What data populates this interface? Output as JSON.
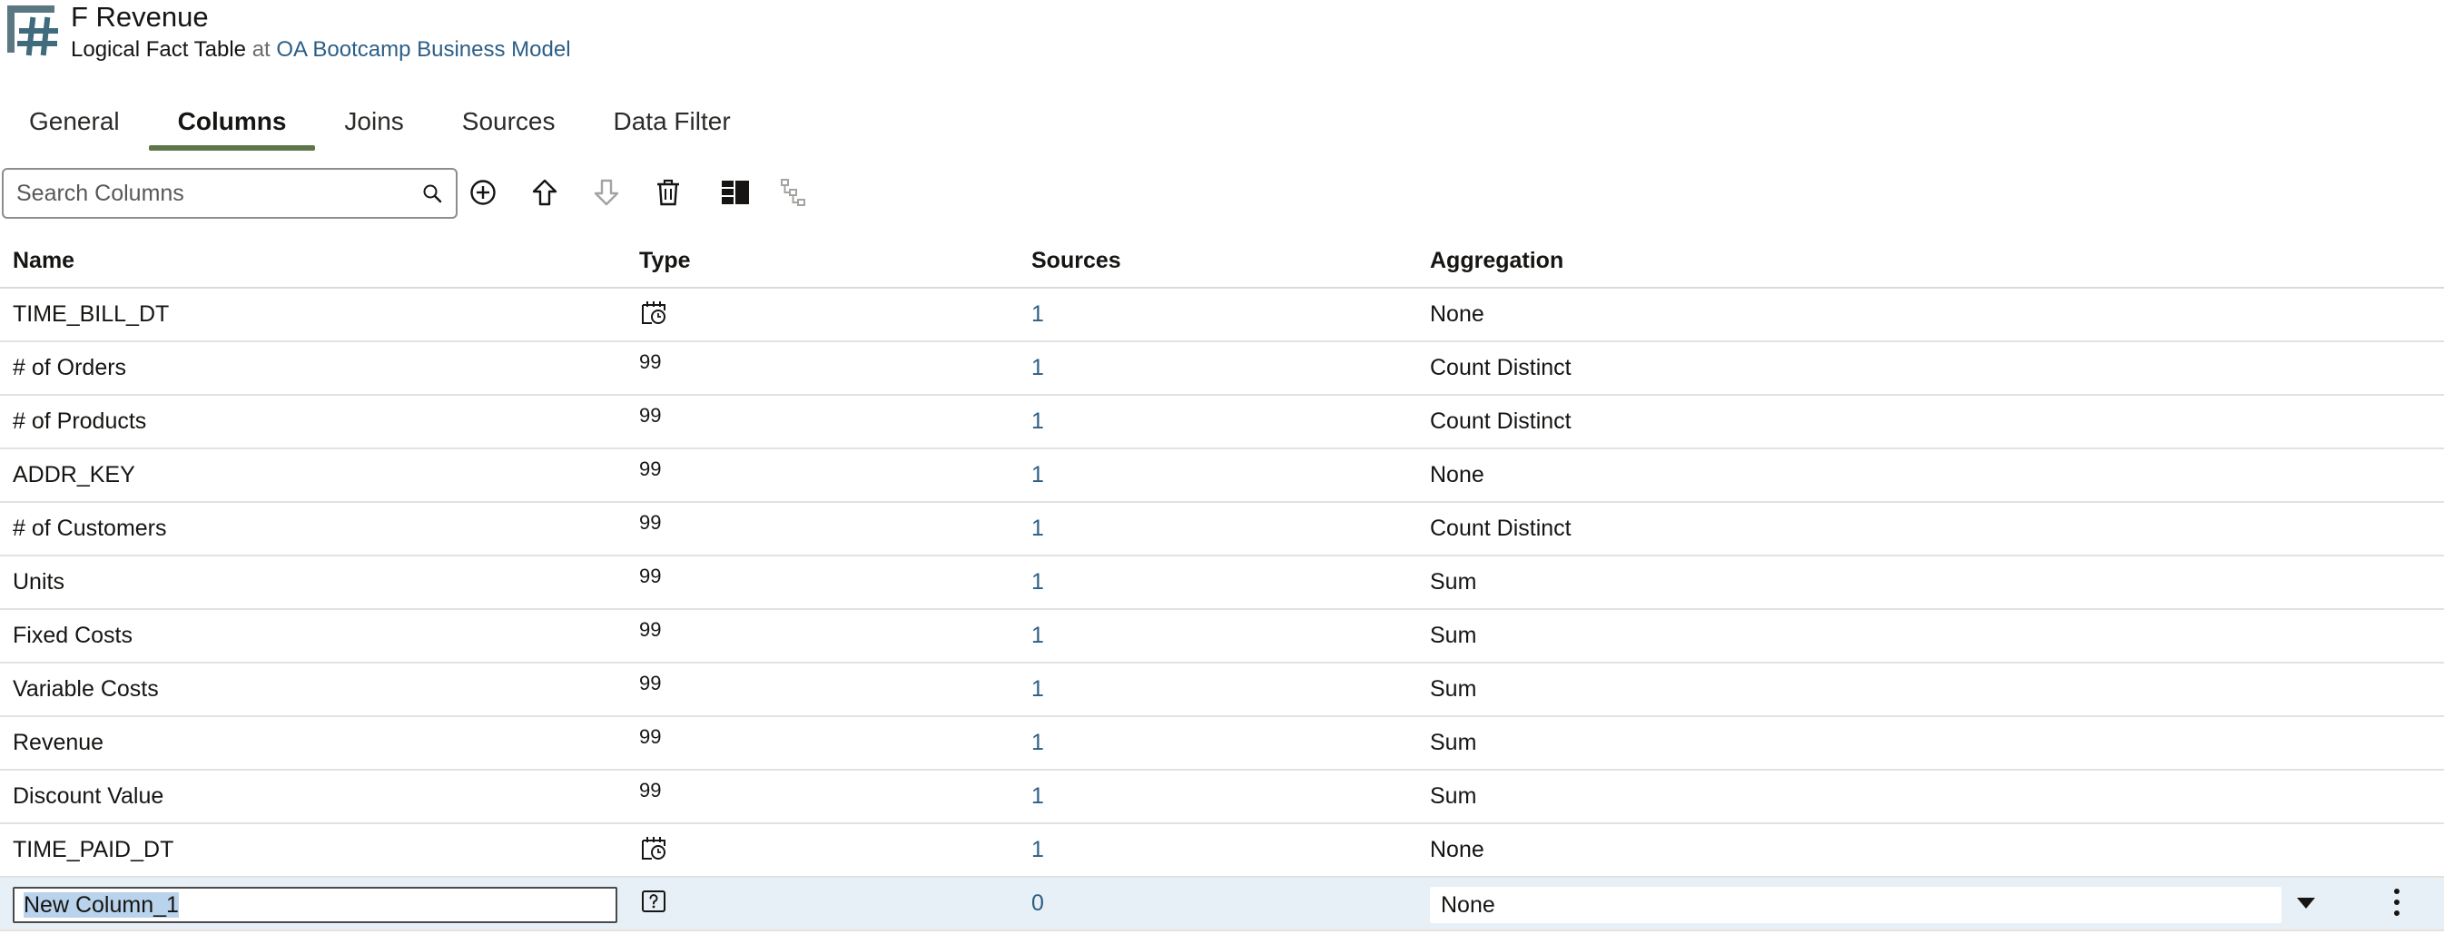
{
  "header": {
    "title": "F Revenue",
    "subtitle_type": "Logical Fact Table",
    "subtitle_at": "at",
    "subtitle_link": "OA Bootcamp Business Model",
    "icon": "logical-fact-table-icon"
  },
  "tabs": [
    {
      "label": "General",
      "active": false
    },
    {
      "label": "Columns",
      "active": true
    },
    {
      "label": "Joins",
      "active": false
    },
    {
      "label": "Sources",
      "active": false
    },
    {
      "label": "Data Filter",
      "active": false
    }
  ],
  "toolbar": {
    "search_placeholder": "Search Columns",
    "search_value": "",
    "icons": [
      "add-icon",
      "move-up-icon",
      "move-down-icon",
      "delete-icon",
      "detail-view-icon",
      "hierarchy-icon"
    ]
  },
  "table": {
    "headers": {
      "name": "Name",
      "type": "Type",
      "sources": "Sources",
      "aggregation": "Aggregation"
    },
    "rows": [
      {
        "name": "TIME_BILL_DT",
        "type": "date",
        "sources": "1",
        "aggregation": "None"
      },
      {
        "name": "# of Orders",
        "type": "99",
        "sources": "1",
        "aggregation": "Count Distinct"
      },
      {
        "name": "# of Products",
        "type": "99",
        "sources": "1",
        "aggregation": "Count Distinct"
      },
      {
        "name": "ADDR_KEY",
        "type": "99",
        "sources": "1",
        "aggregation": "None"
      },
      {
        "name": "# of Customers",
        "type": "99",
        "sources": "1",
        "aggregation": "Count Distinct"
      },
      {
        "name": "Units",
        "type": "99",
        "sources": "1",
        "aggregation": "Sum"
      },
      {
        "name": "Fixed Costs",
        "type": "99",
        "sources": "1",
        "aggregation": "Sum"
      },
      {
        "name": "Variable Costs",
        "type": "99",
        "sources": "1",
        "aggregation": "Sum"
      },
      {
        "name": "Revenue",
        "type": "99",
        "sources": "1",
        "aggregation": "Sum"
      },
      {
        "name": "Discount Value",
        "type": "99",
        "sources": "1",
        "aggregation": "Sum"
      },
      {
        "name": "TIME_PAID_DT",
        "type": "date",
        "sources": "1",
        "aggregation": "None"
      }
    ],
    "new_row": {
      "name": "New Column_1",
      "type": "unknown",
      "sources": "0",
      "aggregation": "None"
    }
  },
  "colors": {
    "accent": "#5e7648",
    "link": "#2c5e86",
    "selected_row": "#e7f0f6"
  }
}
